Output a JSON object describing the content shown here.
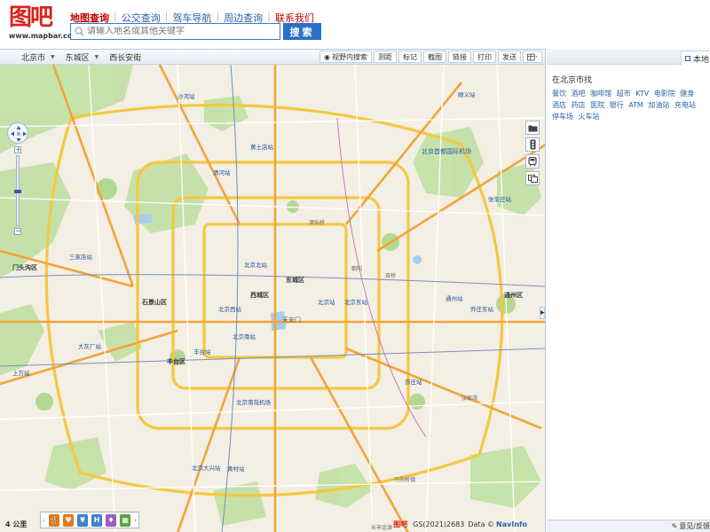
{
  "logo": {
    "text": "图吧",
    "url": "www.mapbar.com"
  },
  "nav": {
    "items": [
      {
        "label": "地图查询"
      },
      {
        "label": "公交查询"
      },
      {
        "label": "驾车导航"
      },
      {
        "label": "周边查询"
      },
      {
        "label": "联系我们"
      }
    ]
  },
  "search": {
    "placeholder": "请输入地名或其他关键字",
    "button": "搜索"
  },
  "toolbar": {
    "city": "北京市",
    "district": "东城区",
    "street": "西长安街",
    "tools": [
      "视野内搜索",
      "测距",
      "标记",
      "截图",
      "链接",
      "打印",
      "发送"
    ]
  },
  "map": {
    "scale": "4 公里",
    "copyright": {
      "brand": "图吧",
      "gs": "GS(2021)2683",
      "data": "Data ©",
      "provider": "NavInfo"
    },
    "labels": {
      "dongcheng": "东城区",
      "xicheng": "西城区",
      "shijingshan": "石景山区",
      "fengtai": "丰台区",
      "tongzhou": "通州区",
      "mentougou": "门头沟区",
      "beijingxi": "北京西站",
      "beijingzhan": "北京站",
      "beijingbei": "北京北站",
      "beijingnan": "北京南站",
      "beijingdong": "北京东站",
      "qinghe": "清河站",
      "huangtudian": "黄土店站",
      "shahe": "沙河站",
      "shunyi": "顺义站",
      "capital": "北京首都国际机场",
      "zhangjiawan": "张辛庄站",
      "tongzhouzhan": "通州站",
      "tongzhouxi": "通州西站",
      "qiaozhuang": "乔庄东站",
      "yizhuang": "亦庄站",
      "nanyuan": "北京南苑机场",
      "daxing": "北京大兴站",
      "huangcun": "黄村站",
      "fengtaizhan": "丰台站",
      "shangfang": "上方站",
      "sanjia": "三家店站",
      "daning": "大灰厂站",
      "tiananmen": "天安门",
      "chaoyang": "朝阳",
      "shuangqiao": "双桥",
      "jiuxianqiao": "酒仙桥",
      "zhangjiazhan": "张家湾",
      "changfeng": "长丰金源",
      "mabaozhen": "马驹桥镇"
    }
  },
  "panel": {
    "tab": "本地",
    "find_title": "在北京市找",
    "categories": [
      "餐饮",
      "酒吧",
      "咖啡馆",
      "超市",
      "KTV",
      "电影院",
      "健身",
      "酒店",
      "药店",
      "医院",
      "银行",
      "ATM",
      "加油站",
      "充电站",
      "停车场",
      "火车站"
    ],
    "footer": "意见/反馈"
  },
  "colors": {
    "accent": "#2a70c8",
    "brand": "#d9231a",
    "map_bg": "#f2efe6",
    "road_yellow": "#f5c842",
    "road_orange": "#f2a43a",
    "green": "#bcdfa0"
  }
}
